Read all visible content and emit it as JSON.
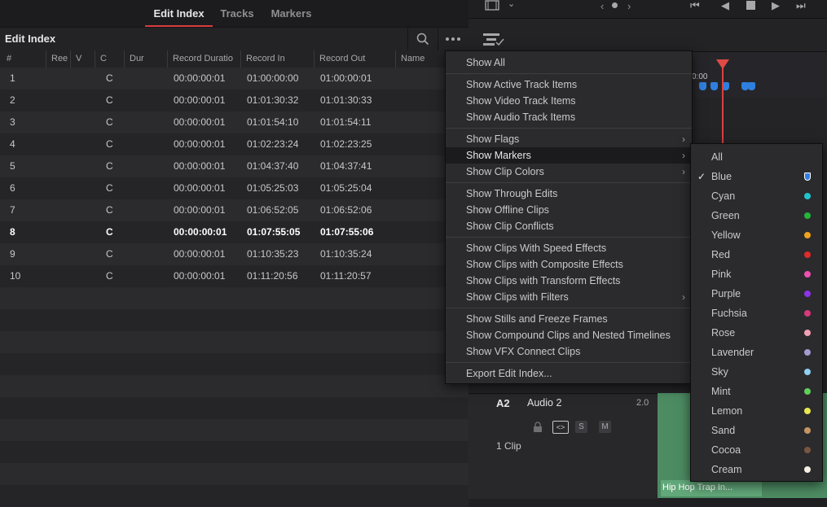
{
  "tabs": [
    "Edit Index",
    "Tracks",
    "Markers"
  ],
  "active_tab": "Edit Index",
  "panel_title": "Edit Index",
  "columns": [
    "#",
    "Ree",
    "V",
    "C",
    "Dur",
    "Record Duratio",
    "Record In",
    "Record Out",
    "Name"
  ],
  "rows": [
    {
      "n": "1",
      "c": "C",
      "dur": "00:00:00:01",
      "in": "01:00:00:00",
      "out": "01:00:00:01"
    },
    {
      "n": "2",
      "c": "C",
      "dur": "00:00:00:01",
      "in": "01:01:30:32",
      "out": "01:01:30:33"
    },
    {
      "n": "3",
      "c": "C",
      "dur": "00:00:00:01",
      "in": "01:01:54:10",
      "out": "01:01:54:11"
    },
    {
      "n": "4",
      "c": "C",
      "dur": "00:00:00:01",
      "in": "01:02:23:24",
      "out": "01:02:23:25"
    },
    {
      "n": "5",
      "c": "C",
      "dur": "00:00:00:01",
      "in": "01:04:37:40",
      "out": "01:04:37:41"
    },
    {
      "n": "6",
      "c": "C",
      "dur": "00:00:00:01",
      "in": "01:05:25:03",
      "out": "01:05:25:04"
    },
    {
      "n": "7",
      "c": "C",
      "dur": "00:00:00:01",
      "in": "01:06:52:05",
      "out": "01:06:52:06"
    },
    {
      "n": "8",
      "c": "C",
      "dur": "00:00:00:01",
      "in": "01:07:55:05",
      "out": "01:07:55:06",
      "bold": true
    },
    {
      "n": "9",
      "c": "C",
      "dur": "00:00:00:01",
      "in": "01:10:35:23",
      "out": "01:10:35:24"
    },
    {
      "n": "10",
      "c": "C",
      "dur": "00:00:00:01",
      "in": "01:11:20:56",
      "out": "01:11:20:57"
    }
  ],
  "menu": [
    {
      "label": "Show All"
    },
    {
      "sep": true
    },
    {
      "label": "Show Active Track Items"
    },
    {
      "label": "Show Video Track Items"
    },
    {
      "label": "Show Audio Track Items"
    },
    {
      "sep": true
    },
    {
      "label": "Show Flags",
      "sub": true
    },
    {
      "label": "Show Markers",
      "sub": true,
      "hl": true
    },
    {
      "label": "Show Clip Colors",
      "sub": true
    },
    {
      "sep": true
    },
    {
      "label": "Show Through Edits"
    },
    {
      "label": "Show Offline Clips"
    },
    {
      "label": "Show Clip Conflicts"
    },
    {
      "sep": true
    },
    {
      "label": "Show Clips With Speed Effects"
    },
    {
      "label": "Show Clips with Composite Effects"
    },
    {
      "label": "Show Clips with Transform Effects"
    },
    {
      "label": "Show Clips with Filters",
      "sub": true
    },
    {
      "sep": true
    },
    {
      "label": "Show Stills and Freeze Frames"
    },
    {
      "label": "Show Compound Clips and Nested Timelines"
    },
    {
      "label": "Show VFX Connect Clips"
    },
    {
      "sep": true
    },
    {
      "label": "Export Edit Index..."
    }
  ],
  "submenu": [
    {
      "label": "All"
    },
    {
      "label": "Blue",
      "color": "#2f7fe0",
      "checked": true,
      "flag": true
    },
    {
      "label": "Cyan",
      "color": "#21c4cf"
    },
    {
      "label": "Green",
      "color": "#22b53a"
    },
    {
      "label": "Yellow",
      "color": "#f0a21b"
    },
    {
      "label": "Red",
      "color": "#e02b2b"
    },
    {
      "label": "Pink",
      "color": "#f04fb2"
    },
    {
      "label": "Purple",
      "color": "#8e34e8"
    },
    {
      "label": "Fuchsia",
      "color": "#d93a7c"
    },
    {
      "label": "Rose",
      "color": "#f2a0b6"
    },
    {
      "label": "Lavender",
      "color": "#a49ad0"
    },
    {
      "label": "Sky",
      "color": "#8fd0f0"
    },
    {
      "label": "Mint",
      "color": "#5fd05a"
    },
    {
      "label": "Lemon",
      "color": "#e8e84f"
    },
    {
      "label": "Sand",
      "color": "#c49563"
    },
    {
      "label": "Cocoa",
      "color": "#7a553f"
    },
    {
      "label": "Cream",
      "color": "#f4efe2"
    }
  ],
  "timeline": {
    "ruler_time": "0:00",
    "track_label": "A2",
    "track_name": "Audio 2",
    "track_level": "2.0",
    "track_clips": "1 Clip",
    "clip_name": "Hip Hop Trap In..."
  }
}
